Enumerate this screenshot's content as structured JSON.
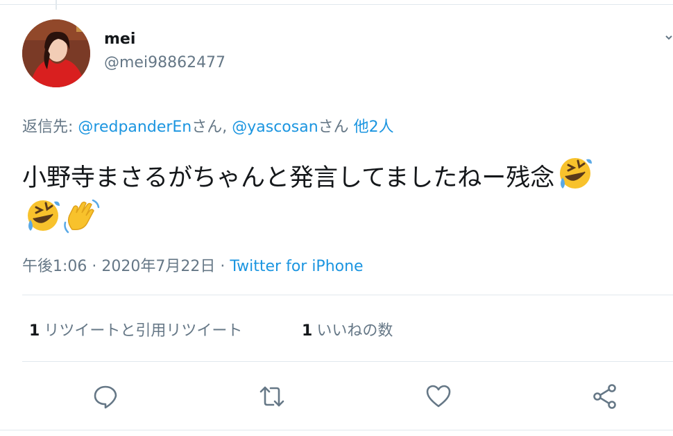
{
  "tweet": {
    "author": {
      "display_name": "mei",
      "handle": "@mei98862477",
      "avatar_icon": "profile-photo"
    },
    "reply_context": {
      "prefix": "返信先: ",
      "mention1": "@redpanderEn",
      "suffix1": "さん, ",
      "mention2": "@yascosan",
      "suffix2": "さん ",
      "others": "他2人"
    },
    "text": "小野寺まさるがちゃんと発言してましたねー残念",
    "emojis": [
      "rolling-on-floor-laughing",
      "rolling-on-floor-laughing",
      "waving-hand"
    ],
    "time": "午後1:06 · 2020年7月22日 · ",
    "source": "Twitter for iPhone",
    "stats": {
      "retweets_count": "1",
      "retweets_label": "リツイートと引用リツイート",
      "likes_count": "1",
      "likes_label": "いいねの数"
    },
    "actions": {
      "reply_icon": "reply-icon",
      "retweet_icon": "retweet-icon",
      "like_icon": "heart-icon",
      "share_icon": "share-icon"
    }
  },
  "colors": {
    "link": "#1b95e0",
    "secondary_text": "#657786",
    "divider": "#e1e8ed"
  }
}
